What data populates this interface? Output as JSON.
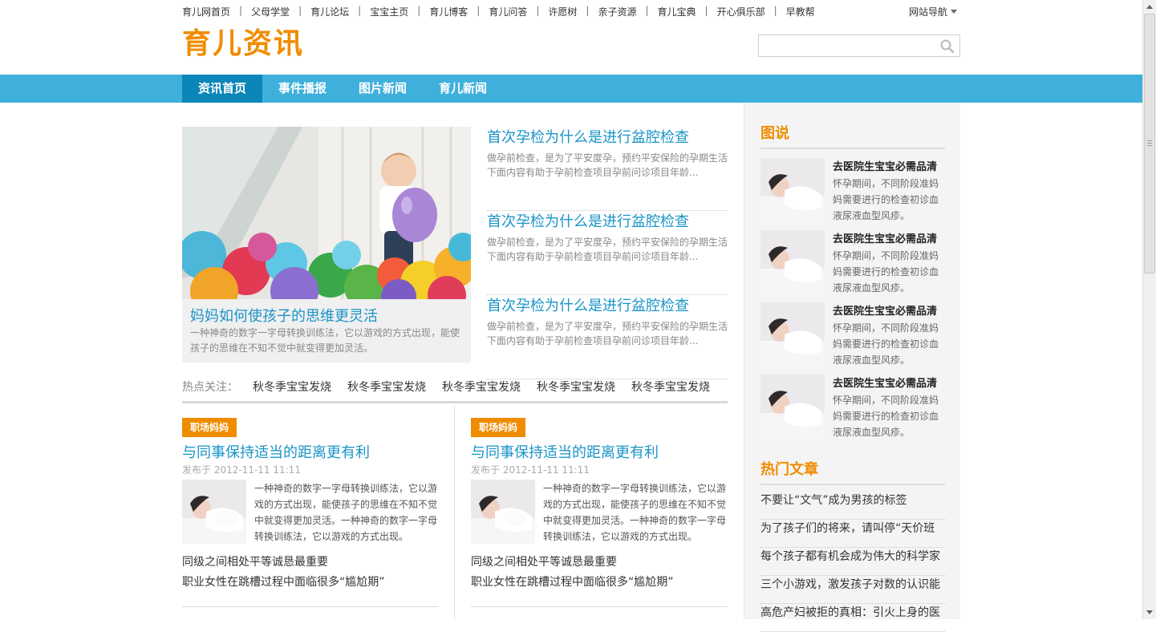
{
  "top_links": [
    "育儿网首页",
    "父母学堂",
    "育儿论坛",
    "宝宝主页",
    "育儿博客",
    "育儿问答",
    "许愿树",
    "亲子资源",
    "育儿宝典",
    "开心俱乐部",
    "早教帮"
  ],
  "site_nav": "网站导航",
  "logo": "育儿资讯",
  "search": {
    "placeholder": ""
  },
  "nav": {
    "items": [
      "资讯首页",
      "事件播报",
      "图片新闻",
      "育儿新闻"
    ],
    "active": 0
  },
  "colors": {
    "accent": "#f08c00",
    "nav_bg": "#3fb0dc",
    "nav_active": "#0c86b8",
    "link_blue": "#1a94c8"
  },
  "featured": {
    "title": "妈妈如何使孩子的思维更灵活",
    "desc": "一种神奇的数字一字母转换训练法，它以游戏的方式出现，能使孩子的思维在不知不觉中就变得更加灵活。"
  },
  "news": [
    {
      "title": "首次孕检为什么是进行盆腔检查",
      "desc": "做孕前检查，是为了平安度孕，预约平安保险的孕期生活下面内容有助于孕前检查项目孕前问诊项目年龄..."
    },
    {
      "title": "首次孕检为什么是进行盆腔检查",
      "desc": "做孕前检查，是为了平安度孕，预约平安保险的孕期生活下面内容有助于孕前检查项目孕前问诊项目年龄..."
    },
    {
      "title": "首次孕检为什么是进行盆腔检查",
      "desc": "做孕前检查，是为了平安度孕，预约平安保险的孕期生活下面内容有助于孕前检查项目孕前问诊项目年龄..."
    }
  ],
  "hot": {
    "label": "热点关注：",
    "tags": [
      "秋冬季宝宝发烧",
      "秋冬季宝宝发烧",
      "秋冬季宝宝发烧",
      "秋冬季宝宝发烧",
      "秋冬季宝宝发烧"
    ]
  },
  "blocks": [
    {
      "badge": "职场妈妈",
      "title": "与同事保持适当的距离更有利",
      "date": "发布于 2012-11-11 11:11",
      "text": "一种神奇的数字一字母转换训练法，它以游戏的方式出现，能使孩子的思维在不知不觉中就变得更加灵活。一种神奇的数字一字母转换训练法，它以游戏的方式出现。",
      "links": [
        "同级之间相处平等诚恳最重要",
        "职业女性在跳槽过程中面临很多“尴尬期”"
      ]
    },
    {
      "badge": "职场妈妈",
      "title": "与同事保持适当的距离更有利",
      "date": "发布于 2012-11-11 11:11",
      "text": "一种神奇的数字一字母转换训练法，它以游戏的方式出现，能使孩子的思维在不知不觉中就变得更加灵活。一种神奇的数字一字母转换训练法，它以游戏的方式出现。",
      "links": [
        "同级之间相处平等诚恳最重要",
        "职业女性在跳槽过程中面临很多“尴尬期”"
      ]
    }
  ],
  "sidebar": {
    "pics_title": "图说",
    "pics": [
      {
        "title": "去医院生宝宝必需品清",
        "desc": "怀孕期间，不同阶段准妈妈需要进行的检查初诊血液尿液血型风疹。"
      },
      {
        "title": "去医院生宝宝必需品清",
        "desc": "怀孕期间，不同阶段准妈妈需要进行的检查初诊血液尿液血型风疹。"
      },
      {
        "title": "去医院生宝宝必需品清",
        "desc": "怀孕期间，不同阶段准妈妈需要进行的检查初诊血液尿液血型风疹。"
      },
      {
        "title": "去医院生宝宝必需品清",
        "desc": "怀孕期间，不同阶段准妈妈需要进行的检查初诊血液尿液血型风疹。"
      }
    ],
    "hot_title": "热门文章",
    "hot_articles": [
      "不要让“文气”成为男孩的标签",
      "为了孩子们的将来，请叫停“天价班",
      "每个孩子都有机会成为伟大的科学家",
      "三个小游戏，激发孩子对数的认识能",
      "高危产妇被拒的真相：引火上身的医"
    ]
  }
}
